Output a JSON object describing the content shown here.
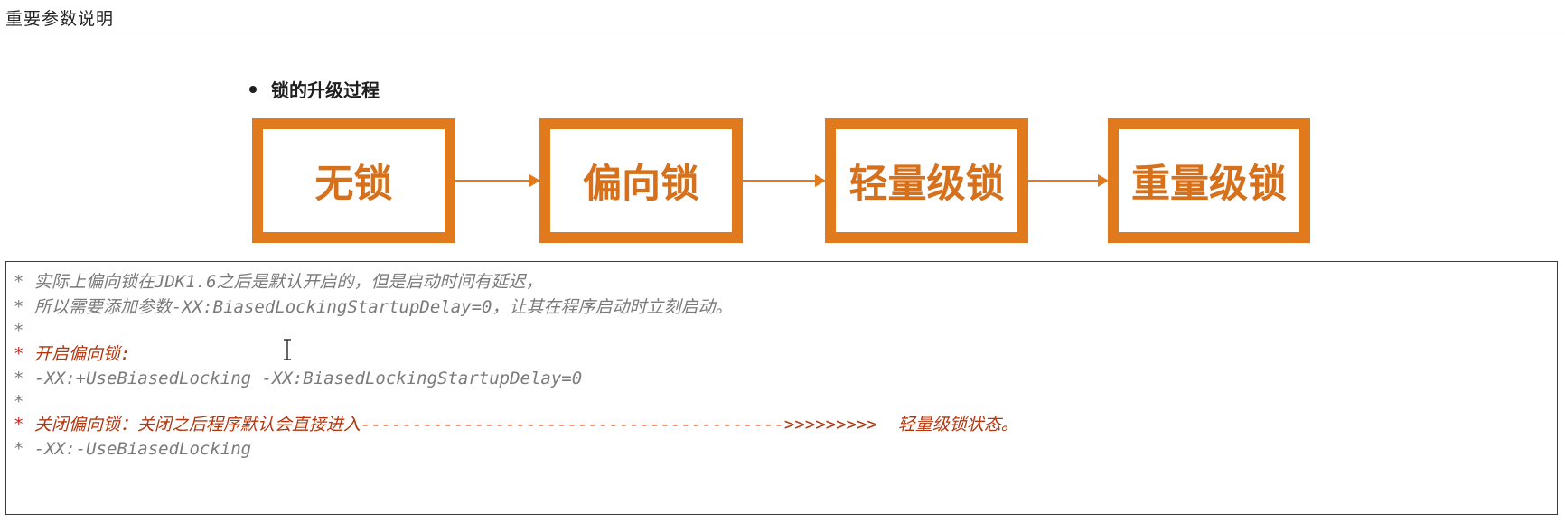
{
  "header": {
    "title": "重要参数说明"
  },
  "section": {
    "bullet_label": "锁的升级过程"
  },
  "flow": {
    "stages": [
      "无锁",
      "偏向锁",
      "轻量级锁",
      "重量级锁"
    ]
  },
  "code": {
    "lines": [
      {
        "star": "*",
        "text": " 实际上偏向锁在JDK1.6之后是默认开启的，但是启动时间有延迟，"
      },
      {
        "star": "*",
        "text": " 所以需要添加参数-XX:BiasedLockingStartupDelay=0，让其在程序启动时立刻启动。"
      },
      {
        "star": "*",
        "text": ""
      },
      {
        "star": "*",
        "text": " 开启偏向锁:"
      },
      {
        "star": "*",
        "text": " -XX:+UseBiasedLocking -XX:BiasedLockingStartupDelay=0"
      },
      {
        "star": "*",
        "text": ""
      },
      {
        "star": "*",
        "text": " 关闭偏向锁：关闭之后程序默认会直接进入----------------------------------------->>>>>>>>>  轻量级锁状态。"
      },
      {
        "star": "*",
        "text": " -XX:-UseBiasedLocking"
      }
    ]
  },
  "colors": {
    "accent_orange": "#e07a1c",
    "comment_gray": "#7a7a7a",
    "highlight_red": "#b4360f"
  }
}
